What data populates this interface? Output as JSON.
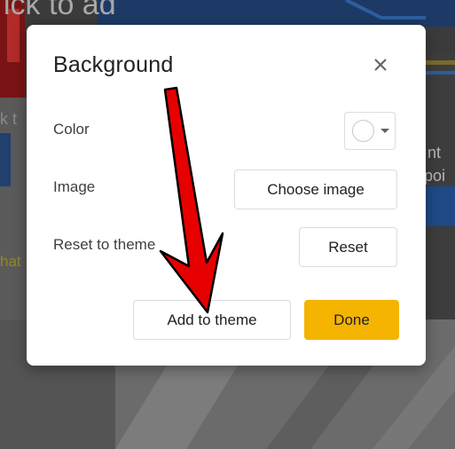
{
  "dialog": {
    "title": "Background",
    "close_icon": "close-icon",
    "rows": {
      "color": {
        "label": "Color",
        "swatch_color": "#ffffff"
      },
      "image": {
        "label": "Image",
        "button_label": "Choose image"
      },
      "reset": {
        "label": "Reset to theme",
        "button_label": "Reset"
      }
    },
    "footer": {
      "add_to_theme_label": "Add to theme",
      "done_label": "Done"
    }
  },
  "background_slide": {
    "partial_text_top": "ick to ad",
    "partial_text_left": "k t",
    "partial_text_yellow": "hat",
    "partial_text_right_1": "nt",
    "partial_text_right_2": "poi"
  },
  "colors": {
    "accent": "#f4b400",
    "annotation_arrow": "#e60000"
  }
}
